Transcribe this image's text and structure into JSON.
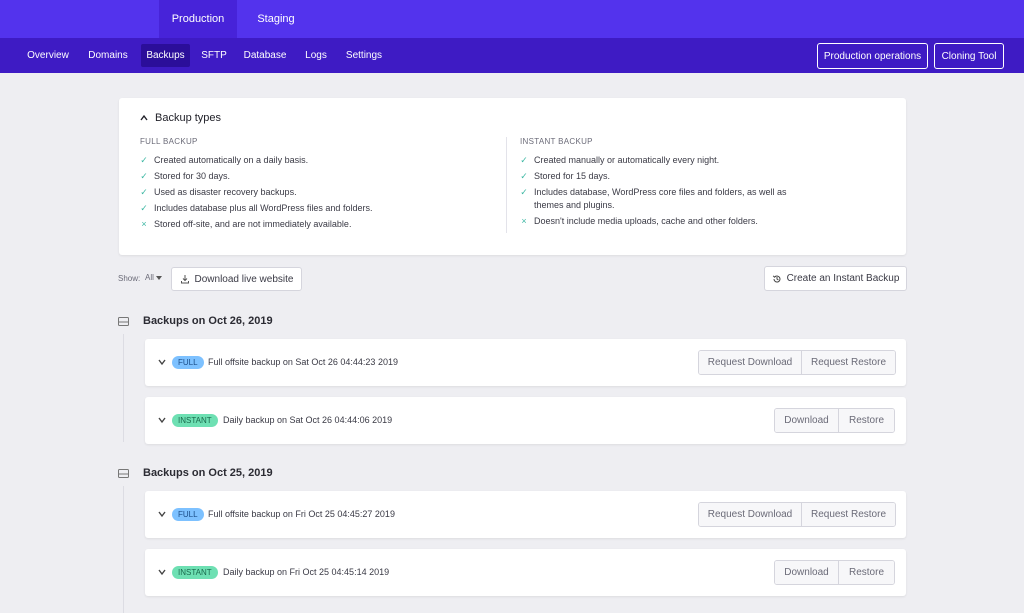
{
  "env_tabs": [
    {
      "label": "Production",
      "active": true
    },
    {
      "label": "Staging",
      "active": false
    }
  ],
  "nav": {
    "items": [
      {
        "label": "Overview",
        "active": false
      },
      {
        "label": "Domains",
        "active": false
      },
      {
        "label": "Backups",
        "active": true
      },
      {
        "label": "SFTP",
        "active": false
      },
      {
        "label": "Database",
        "active": false
      },
      {
        "label": "Logs",
        "active": false
      },
      {
        "label": "Settings",
        "active": false
      }
    ],
    "production_operations_label": "Production operations",
    "cloning_tool_label": "Cloning Tool"
  },
  "backup_types": {
    "title": "Backup types",
    "full": {
      "title": "FULL BACKUP",
      "features": [
        {
          "text": "Created automatically on a daily basis.",
          "included": true
        },
        {
          "text": "Stored for 30 days.",
          "included": true
        },
        {
          "text": "Used as disaster recovery backups.",
          "included": true
        },
        {
          "text": "Includes database plus all WordPress files and folders.",
          "included": true
        },
        {
          "text": "Stored off-site, and are not immediately available.",
          "included": false
        }
      ]
    },
    "instant": {
      "title": "INSTANT BACKUP",
      "features": [
        {
          "text": "Created manually or automatically every night.",
          "included": true
        },
        {
          "text": "Stored for 15 days.",
          "included": true
        },
        {
          "text": "Includes database, WordPress core files and folders, as well as themes and plugins.",
          "included": true
        },
        {
          "text": "Doesn't include media uploads, cache and other folders.",
          "included": false
        }
      ]
    }
  },
  "toolbar": {
    "show_label": "Show:",
    "show_value": "All",
    "download_live_label": "Download live website",
    "create_instant_label": "Create an Instant Backup"
  },
  "groups": [
    {
      "title": "Backups on Oct 26, 2019",
      "backups": [
        {
          "badge": "FULL",
          "kind": "full",
          "description": "Full offsite backup on Sat Oct 26 04:44:23 2019",
          "action1": "Request Download",
          "action2": "Request Restore"
        },
        {
          "badge": "INSTANT",
          "kind": "instant",
          "description": "Daily backup on Sat Oct 26 04:44:06 2019",
          "action1": "Download",
          "action2": "Restore"
        }
      ]
    },
    {
      "title": "Backups on Oct 25, 2019",
      "backups": [
        {
          "badge": "FULL",
          "kind": "full",
          "description": "Full offsite backup on Fri Oct 25 04:45:27 2019",
          "action1": "Request Download",
          "action2": "Request Restore"
        },
        {
          "badge": "INSTANT",
          "kind": "instant",
          "description": "Daily backup on Fri Oct 25 04:45:14 2019",
          "action1": "Download",
          "action2": "Restore"
        }
      ]
    }
  ],
  "colors": {
    "env_bar": "#5333ed",
    "nav_bar": "#3e1bc4",
    "badge_full": "#7dc1ff",
    "badge_instant": "#6ee0b3",
    "check": "#3fb8a4"
  }
}
